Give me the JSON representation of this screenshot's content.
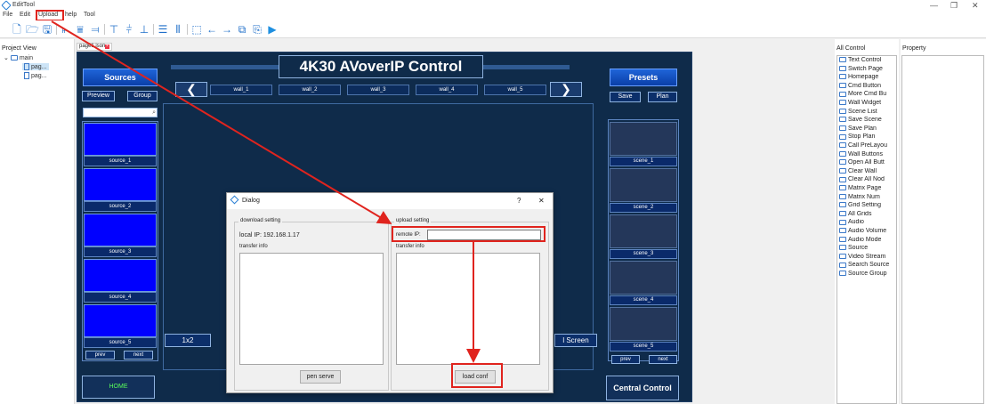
{
  "window": {
    "title": "EditTool",
    "min": "—",
    "max": "❐",
    "close": "✕"
  },
  "menu": [
    "File",
    "Edit",
    "Upload",
    "help",
    "Tool"
  ],
  "project": {
    "header": "Project View",
    "root": "main",
    "children": [
      "pag...",
      "pag..."
    ]
  },
  "tab": {
    "label": "page1.json"
  },
  "canvas": {
    "title": "4K30 AVoverIP Control",
    "sources_header": "Sources",
    "preview": "Preview",
    "group": "Group",
    "sources": [
      "source_1",
      "source_2",
      "source_3",
      "source_4",
      "source_5"
    ],
    "prev": "prev",
    "next": "next",
    "home": "HOME",
    "walls": [
      "wall_1",
      "wall_2",
      "wall_3",
      "wall_4",
      "wall_5"
    ],
    "layout_btn": "1x2",
    "fullscreen_btn": "l Screen",
    "presets_header": "Presets",
    "save": "Save",
    "plan": "Plan",
    "scenes": [
      "scene_1",
      "scene_2",
      "scene_3",
      "scene_4",
      "scene_5"
    ],
    "central_control": "Central Control"
  },
  "dialog": {
    "title": "Dialog",
    "help": "?",
    "close": "✕",
    "download_group": "download setting",
    "local_ip": "local IP: 192.168.1.17",
    "transfer_info_left": "transfer info",
    "open_server_btn": "pen serve",
    "upload_group": "upload setting",
    "remote_ip_label": "remote IP:",
    "remote_ip_value": "",
    "transfer_info_right": "transfer info",
    "upload_btn": "load conf"
  },
  "all_control": {
    "header": "All Control",
    "items": [
      "Text Control",
      "Switch Page",
      "Homepage",
      "Cmd Button",
      "More Cmd Bu",
      "Wall Widget",
      "Scene List",
      "Save Scene",
      "Save Plan",
      "Stop Plan",
      "Call PreLayou",
      "Wall Buttons",
      "Open All Butt",
      "Clear Wall",
      "Clear All Nod",
      "Matrix Page",
      "Matrix Num",
      "Grid Setting",
      "All Grids",
      "Audio",
      "Audio Volume",
      "Audio Mode",
      "Source",
      "Video Stream",
      "Search Source",
      "Source Group"
    ]
  },
  "property": {
    "header": "Property"
  },
  "colors": {
    "canvas_bg": "#0f2b4a",
    "source_blue": "#0000ff",
    "annotation_red": "#e0241e",
    "toolbar_icon": "#1f6fc9"
  }
}
